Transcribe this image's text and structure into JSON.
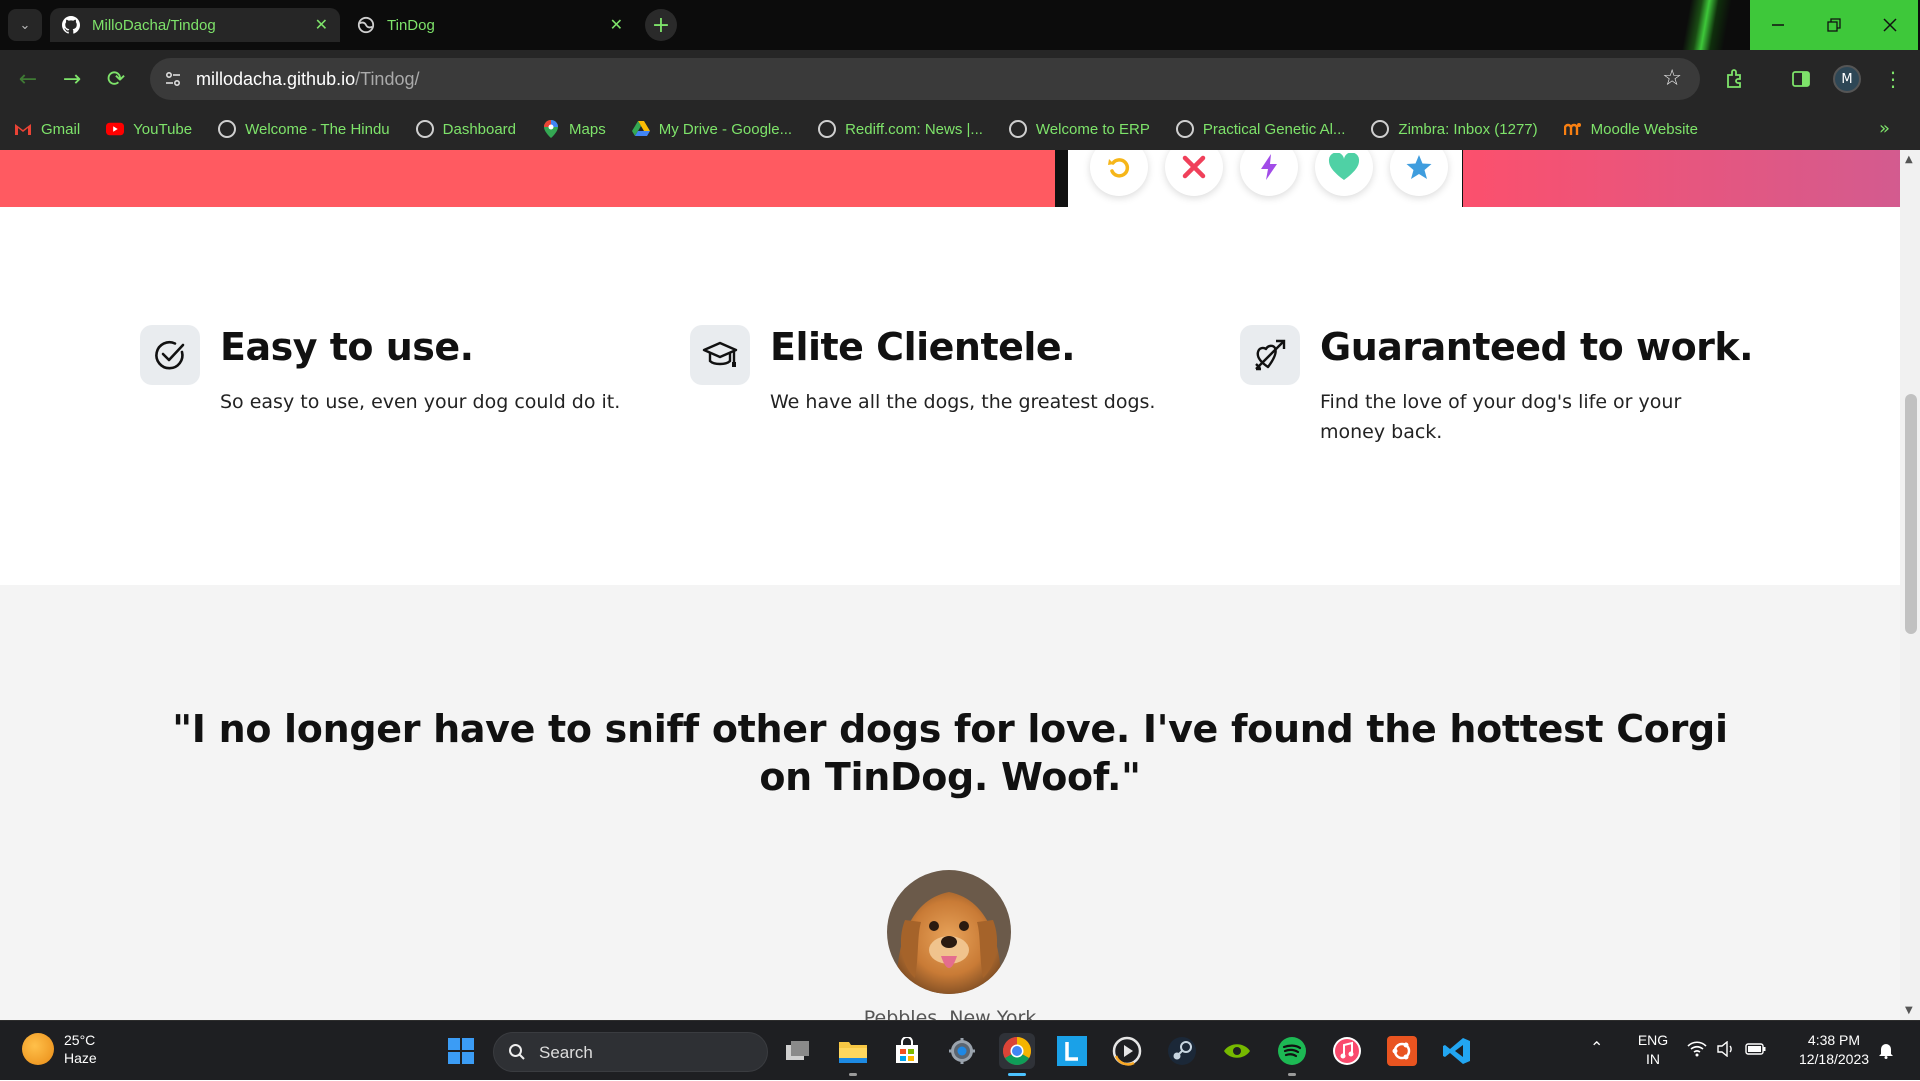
{
  "browser": {
    "tabs": [
      {
        "title": "MilloDacha/Tindog",
        "active": true,
        "favicon": "github-icon"
      },
      {
        "title": "TinDog",
        "active": false,
        "favicon": "globe-icon"
      }
    ],
    "new_tab_label": "+",
    "url_host": "millodacha.github.io",
    "url_path": "/Tindog/",
    "profile_initial": "M",
    "accent_color": "#7ee36a",
    "bookmarks": [
      {
        "label": "Gmail",
        "icon": "gmail-icon"
      },
      {
        "label": "YouTube",
        "icon": "youtube-icon"
      },
      {
        "label": "Welcome - The Hindu",
        "icon": "globe-icon"
      },
      {
        "label": "Dashboard",
        "icon": "globe-icon"
      },
      {
        "label": "Maps",
        "icon": "maps-icon"
      },
      {
        "label": "My Drive - Google...",
        "icon": "drive-icon"
      },
      {
        "label": "Rediff.com: News |...",
        "icon": "globe-icon"
      },
      {
        "label": "Welcome to ERP",
        "icon": "globe-icon"
      },
      {
        "label": "Practical Genetic Al...",
        "icon": "globe-icon"
      },
      {
        "label": "Zimbra: Inbox (1277)",
        "icon": "globe-icon"
      },
      {
        "label": "Moodle Website",
        "icon": "moodle-icon"
      }
    ]
  },
  "page": {
    "features": [
      {
        "title": "Easy to use.",
        "text": "So easy to use, even your dog could do it.",
        "icon": "check-circle-icon"
      },
      {
        "title": "Elite Clientele.",
        "text": "We have all the dogs, the greatest dogs.",
        "icon": "graduation-cap-icon"
      },
      {
        "title": "Guaranteed to work.",
        "text": "Find the love of your dog's life or your money back.",
        "icon": "heart-arrow-icon"
      }
    ],
    "testimonial": {
      "quote": "\"I no longer have to sniff other dogs for love. I've found the hottest Corgi on TinDog. Woof.\"",
      "byline": "Pebbles, New York"
    },
    "brand_color": "#ff5a61"
  },
  "taskbar": {
    "weather_temp": "25°C",
    "weather_desc": "Haze",
    "search_label": "Search",
    "lang_line1": "ENG",
    "lang_line2": "IN",
    "time": "4:38 PM",
    "date": "12/18/2023"
  }
}
